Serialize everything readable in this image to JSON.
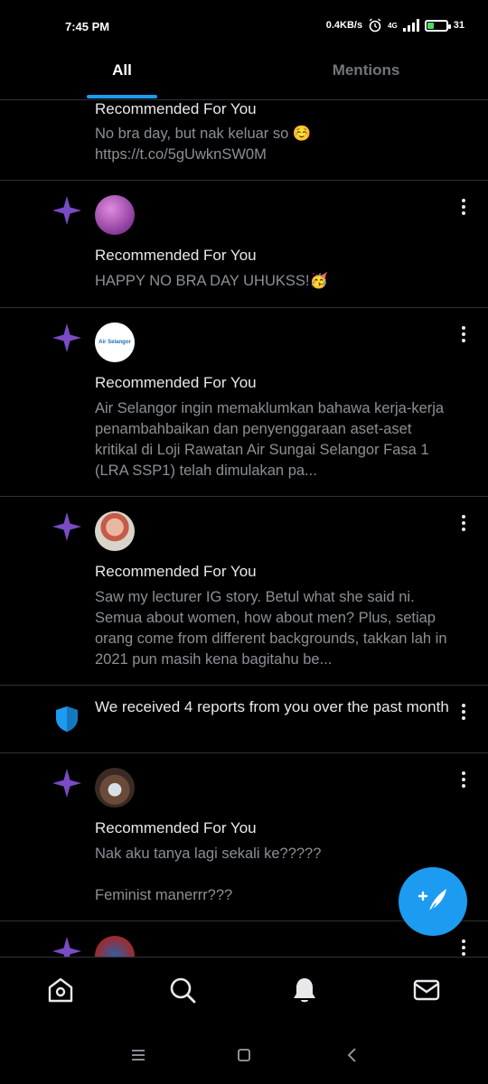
{
  "status_bar": {
    "time": "7:45 PM",
    "network_speed": "0.4KB/s",
    "network_type": "4G",
    "battery_level": "31",
    "battery_fraction": 0.31
  },
  "tabs": [
    {
      "label": "All",
      "active": true
    },
    {
      "label": "Mentions",
      "active": false
    }
  ],
  "notifications": [
    {
      "label": "Recommended For You",
      "text": "No bra day, but nak keluar so ☺️\nhttps://t.co/5gUwknSW0M"
    },
    {
      "label": "Recommended For You",
      "text": "HAPPY NO BRA DAY UHUKSS!🥳"
    },
    {
      "label": "Recommended For You",
      "avatar_text": "Air Selangor",
      "text": "Air Selangor ingin memaklumkan bahawa kerja-kerja penambahbaikan dan penyenggaraan aset-aset kritikal di Loji Rawatan Air Sungai Selangor Fasa 1 (LRA SSP1) telah dimulakan pa..."
    },
    {
      "label": "Recommended For You",
      "text": "Saw my lecturer IG story. Betul what she said ni. Semua about women, how about men? Plus, setiap orang come from different backgrounds, takkan lah in 2021 pun masih kena bagitahu be..."
    },
    {
      "text": "We received 4 reports from you over the past month"
    },
    {
      "label": "Recommended For You",
      "text": "Nak aku tanya lagi sekali ke?????\n\nFeminist manerrr???"
    }
  ],
  "colors": {
    "accent": "#1d9bf0",
    "spark": "#794bc4",
    "background": "#000000",
    "divider": "#2f3336",
    "muted_text": "#8b9095"
  },
  "icons": {
    "nav": [
      "home-icon",
      "search-icon",
      "notifications-bell-icon",
      "messages-mail-icon"
    ],
    "fab": "compose-tweet-icon",
    "system": [
      "recent-apps-icon",
      "home-square-icon",
      "back-icon"
    ]
  }
}
